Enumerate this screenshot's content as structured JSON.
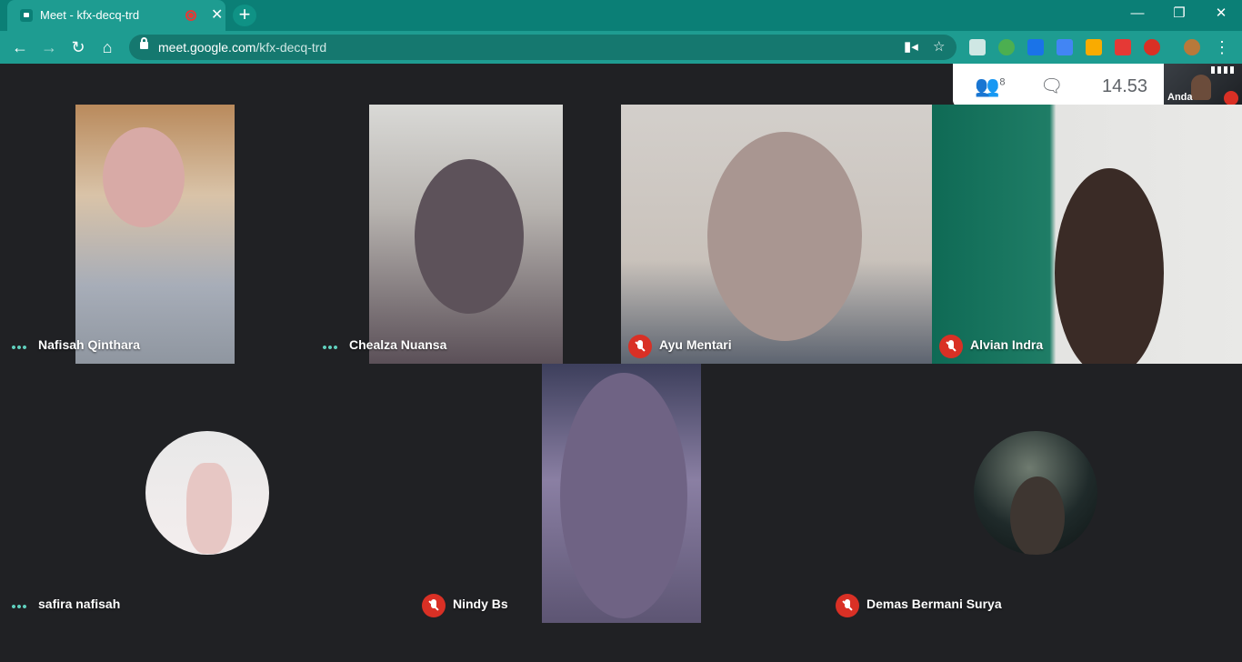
{
  "browser": {
    "tab_title": "Meet - kfx-decq-trd",
    "tab_close": "✕",
    "new_tab": "+",
    "url_host": "meet.google.com",
    "url_path": "/kfx-decq-trd",
    "window_controls": [
      "—",
      "❐",
      "✕"
    ]
  },
  "meet": {
    "participants_count": "8",
    "time": "14.53",
    "self_label": "Anda",
    "participants": [
      {
        "name": "Nafisah Qinthara",
        "muted": false
      },
      {
        "name": "Chealza Nuansa",
        "muted": false
      },
      {
        "name": "Ayu Mentari",
        "muted": true
      },
      {
        "name": "Alvian Indra",
        "muted": true
      },
      {
        "name": "safira nafisah",
        "muted": false
      },
      {
        "name": "Nindy Bs",
        "muted": true
      },
      {
        "name": "Demas Bermani Surya",
        "muted": true
      }
    ]
  },
  "colors": {
    "titlebar": "#0b7f76",
    "toolbar": "#1e9c91",
    "meet_bg": "#202124",
    "mute_red": "#d93025",
    "dots_teal": "#5fcfbd"
  }
}
